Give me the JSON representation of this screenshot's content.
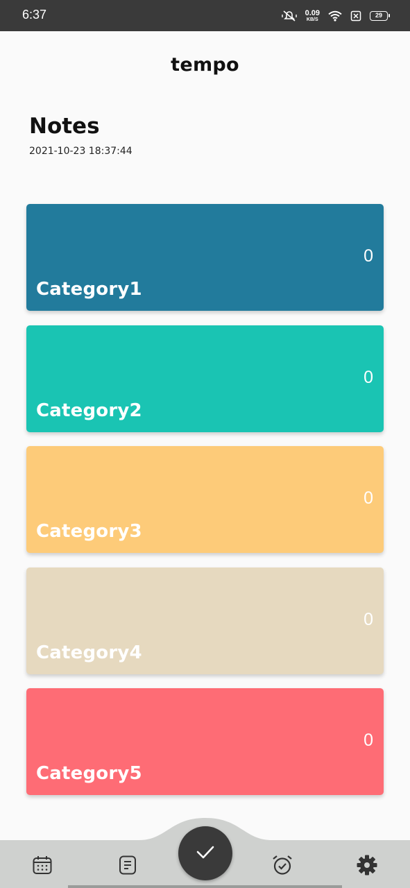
{
  "status_bar": {
    "time": "6:37",
    "net_speed": "0.09",
    "net_unit": "KB/S",
    "battery": "29",
    "icons": [
      "mute-vibrate-icon",
      "wifi-icon",
      "sim-x-icon",
      "battery-icon"
    ]
  },
  "app": {
    "title": "tempo"
  },
  "page": {
    "title": "Notes",
    "date": "2021-10-23 18:37:44"
  },
  "categories": [
    {
      "name": "Category1",
      "count": "0",
      "color": "#227b9c"
    },
    {
      "name": "Category2",
      "count": "0",
      "color": "#1ac4b3"
    },
    {
      "name": "Category3",
      "count": "0",
      "color": "#fdcb79"
    },
    {
      "name": "Category4",
      "count": "0",
      "color": "#e6d9bf"
    },
    {
      "name": "Category5",
      "count": "0",
      "color": "#fe6c75"
    }
  ],
  "bottom_nav": {
    "items": [
      "calendar-icon",
      "notes-icon",
      "check-icon",
      "alarm-icon",
      "gear-icon"
    ],
    "nav_color": "#cfd1cf",
    "fab_color": "#3a3a3a"
  }
}
